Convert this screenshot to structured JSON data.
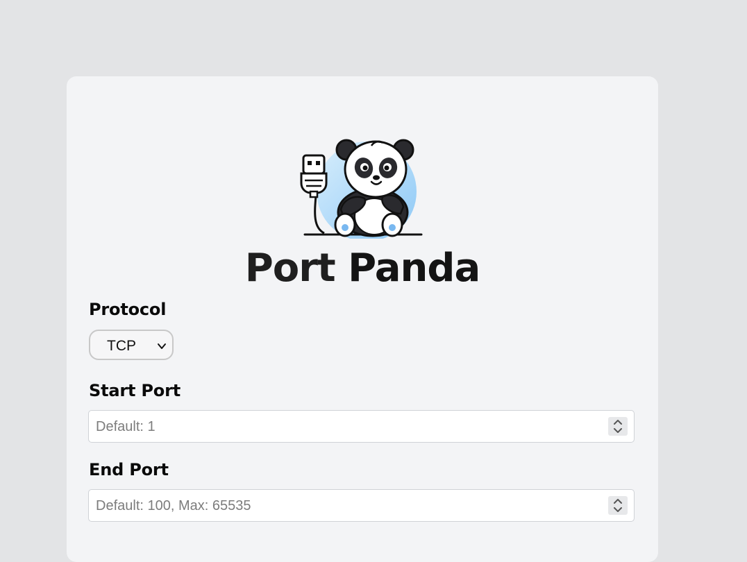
{
  "app": {
    "title_word1": "Port",
    "title_word2": "Panda"
  },
  "form": {
    "protocol": {
      "label": "Protocol",
      "selected": "TCP"
    },
    "start_port": {
      "label": "Start Port",
      "placeholder": "Default: 1"
    },
    "end_port": {
      "label": "End Port",
      "placeholder": "Default: 100, Max: 65535"
    }
  },
  "icons": {
    "logo": "panda-with-usb-plug-icon",
    "select_arrow": "chevron-down-icon",
    "spinner": "number-spinner-icon"
  },
  "colors": {
    "page_bg": "#e3e4e6",
    "card_bg": "#f3f4f6",
    "logo_circle": "#bfe0fb",
    "text": "#0a0a0a"
  }
}
